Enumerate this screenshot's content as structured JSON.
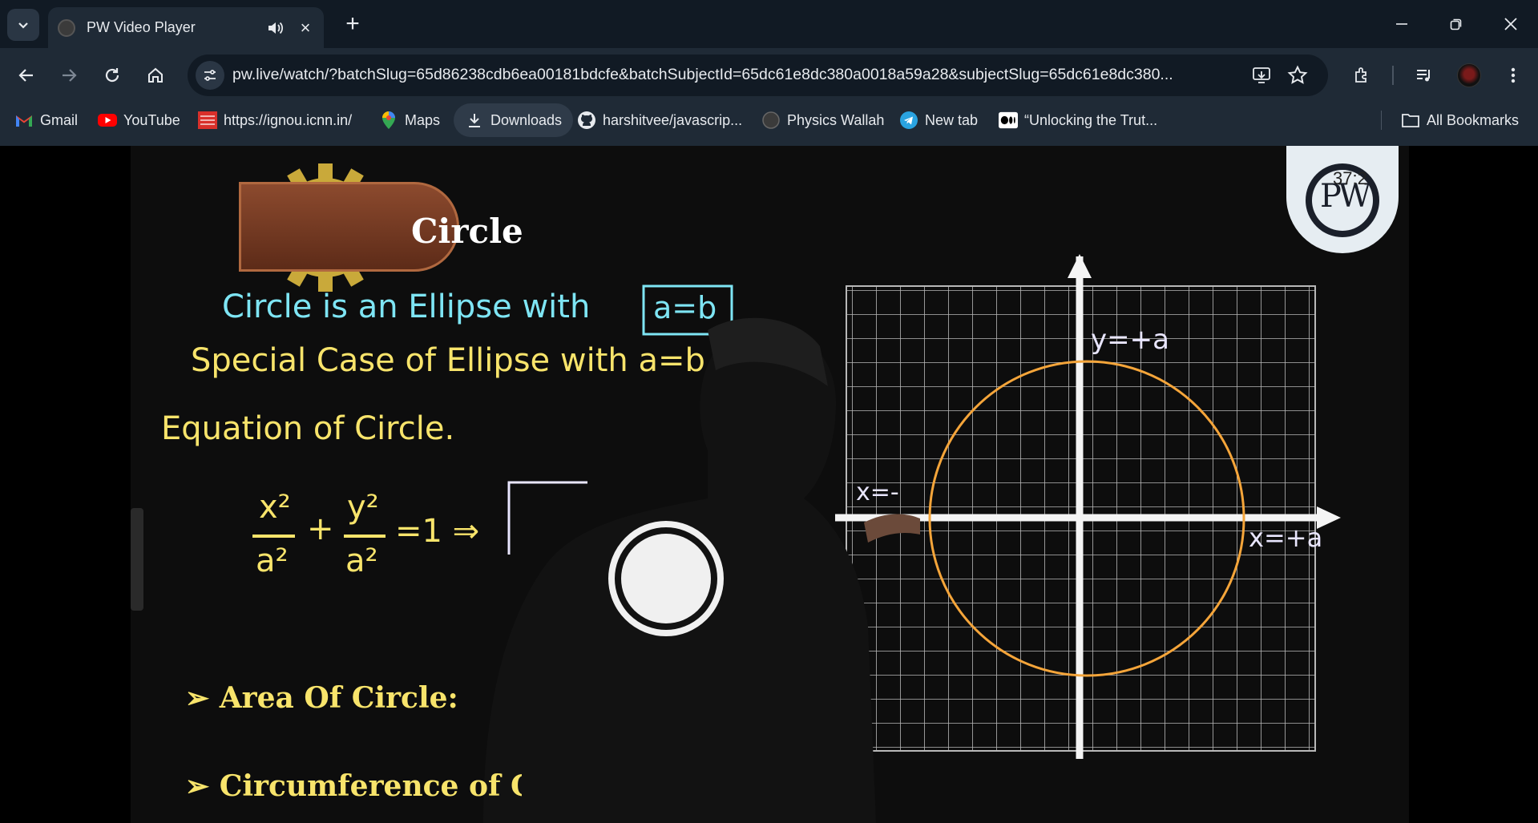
{
  "browser": {
    "tab": {
      "title": "PW Video Player"
    },
    "url": "pw.live/watch/?batchSlug=65d86238cdb6ea00181bdcfe&batchSubjectId=65dc61e8dc380a0018a59a28&subjectSlug=65dc61e8dc380...",
    "bookmarks": [
      {
        "label": "Gmail",
        "icon": "gmail-icon"
      },
      {
        "label": "YouTube",
        "icon": "youtube-icon"
      },
      {
        "label": "https://ignou.icnn.in/",
        "icon": "icnn-icon"
      },
      {
        "label": "Maps",
        "icon": "maps-icon"
      },
      {
        "label": "Downloads",
        "icon": "download-icon"
      },
      {
        "label": "harshitvee/javascrip...",
        "icon": "github-icon"
      },
      {
        "label": "Physics Wallah",
        "icon": "pw-icon"
      },
      {
        "label": "New tab",
        "icon": "telegram-icon"
      },
      {
        "label": "“Unlocking the Trut...",
        "icon": "medium-icon"
      }
    ],
    "all_bookmarks": "All Bookmarks"
  },
  "video": {
    "lesson_title": "Circle",
    "line1": "Circle is an Ellipse with",
    "boxed": "a=b",
    "line2": "Special Case of Ellipse with a=b",
    "line3": "Equation of Circle.",
    "eq_num1": "x²",
    "eq_den1": "a²",
    "eq_plus": "+",
    "eq_num2": "y²",
    "eq_den2": "a²",
    "eq_rhs": "=1 ⇒",
    "label_y": "y=+a",
    "label_x_pos": "x=+a",
    "label_x_neg": "x=-",
    "bullet1": "Area Of Circle:",
    "bullet2": "Circumference of C",
    "timer": "37:2",
    "badge_letters": "PW"
  },
  "colors": {
    "chrome_bg": "#1f2a36",
    "tabstrip_bg": "#111a24",
    "chalk_blue": "#7ee5f4",
    "chalk_yellow": "#f8e46b",
    "circle_orange": "#f5a53a"
  }
}
